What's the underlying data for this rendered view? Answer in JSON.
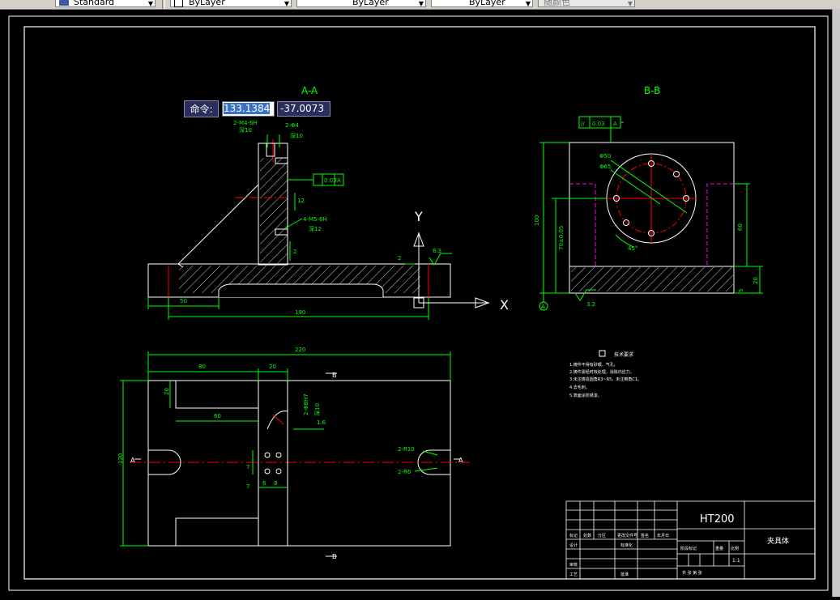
{
  "toolbar": {
    "text_style": "Standard",
    "color": "ByLayer",
    "linetype": "ByLayer",
    "lineweight": "ByLayer",
    "plot_style": "随颜色"
  },
  "command": {
    "label": "命令:",
    "x_value": "133.1384",
    "y_value": "-37.0073"
  },
  "drawing": {
    "section_aa": "A-A",
    "section_bb": "B-B",
    "axis_x": "X",
    "axis_y": "Y",
    "aa_dims": {
      "d50": "50",
      "d190": "190",
      "thread_top": "2-M4-6H",
      "thread_top_depth": "深10",
      "thread_top_b": "2-Φ4",
      "thread_top_b_depth": "深10",
      "flatness": "0.03",
      "datum_a": "A",
      "thread_mid": "4-M5-6H",
      "thread_mid_depth": "深12",
      "d2": "2",
      "d2b": "2",
      "rough63": "6.3",
      "d12": "12"
    },
    "bb_dims": {
      "parallel": "//",
      "tol": "0.03",
      "datum": "A",
      "phi50": "Φ50",
      "phi65": "Φ65",
      "ang45": "45°",
      "d60": "60",
      "d100": "100",
      "d70": "70±0.05",
      "d20": "20",
      "d5": "5",
      "d32": "3.2",
      "datum_circle": "A"
    },
    "plan_dims": {
      "d220": "220",
      "d80": "80",
      "d20": "20",
      "d20v": "20",
      "d60": "60",
      "d120": "120",
      "d7a": "7",
      "d7b": "7",
      "d6": "6",
      "d8": "8",
      "d16": "1.6",
      "r10": "2-R10",
      "r6": "2-R6",
      "sec_b_top": "B",
      "sec_b_bot": "B",
      "sec_a_left": "A",
      "sec_a_right": "A",
      "hole_note": "2-Φ8H7",
      "hole_note2": "深10"
    },
    "tech_title": "技术要求",
    "tech_notes": [
      "1.铸件不得有砂眼、气孔。",
      "2.铸件需经时效处理，消除内应力。",
      "3.未注铸造圆角R3~R5，未注倒角C1。",
      "4.去毛刺。",
      "5.表面涂防锈漆。"
    ]
  },
  "title_block": {
    "material": "HT200",
    "part_name": "夹具体",
    "row_labels": [
      "标记",
      "处数",
      "分区",
      "更改文件号",
      "签名",
      "年月日"
    ],
    "design": "设计",
    "standard": "标准化",
    "review": "审核",
    "process": "工艺",
    "approve": "批准",
    "stage": "阶段标记",
    "weight": "重量",
    "scale": "比例",
    "scale_val": "1:1",
    "sheet": "共  张  第  张"
  }
}
